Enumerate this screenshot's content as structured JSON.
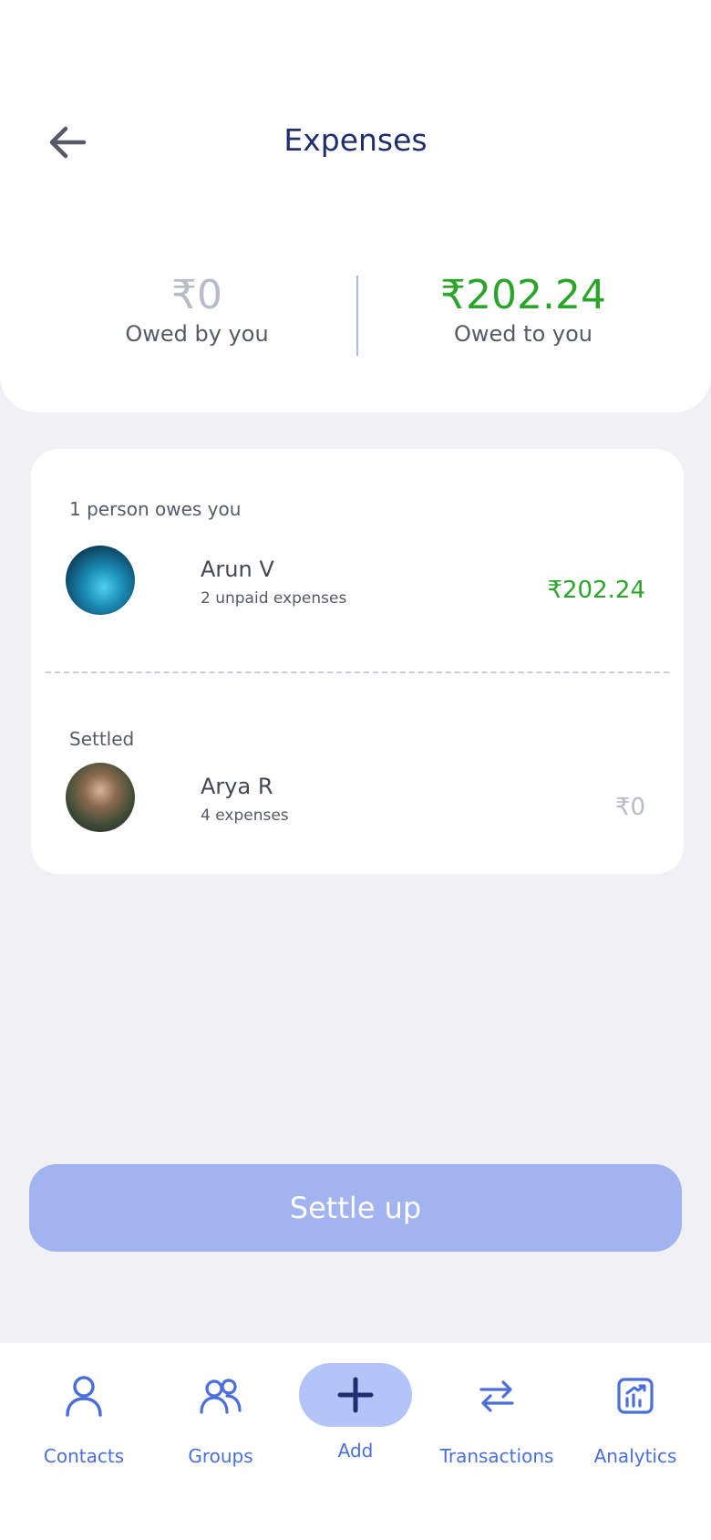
{
  "header": {
    "title": "Expenses",
    "back_icon": "arrow-left-icon"
  },
  "summary": {
    "owed_by_you": {
      "amount": "₹0",
      "label": "Owed by you"
    },
    "owed_to_you": {
      "amount": "₹202.24",
      "label": "Owed to you"
    }
  },
  "balances": {
    "owing_section_label": "1 person owes you",
    "owing": [
      {
        "name": "Arun V",
        "sub": "2 unpaid expenses",
        "amount": "₹202.24"
      }
    ],
    "settled_section_label": "Settled",
    "settled": [
      {
        "name": "Arya R",
        "sub": "4 expenses",
        "amount": "₹0"
      }
    ]
  },
  "settle_button": {
    "label": "Settle up"
  },
  "nav": {
    "items": [
      {
        "label": "Contacts",
        "icon": "person-icon"
      },
      {
        "label": "Groups",
        "icon": "group-icon"
      },
      {
        "label": "Add",
        "icon": "plus-icon"
      },
      {
        "label": "Transactions",
        "icon": "transfer-arrows-icon"
      },
      {
        "label": "Analytics",
        "icon": "chart-icon"
      }
    ]
  },
  "colors": {
    "accent": "#4a6fdc",
    "title": "#1e2e6e",
    "positive": "#2aa52a",
    "muted": "#b8bcc8",
    "settle_button": "#a2b4ef",
    "background": "#f0f0f5"
  }
}
